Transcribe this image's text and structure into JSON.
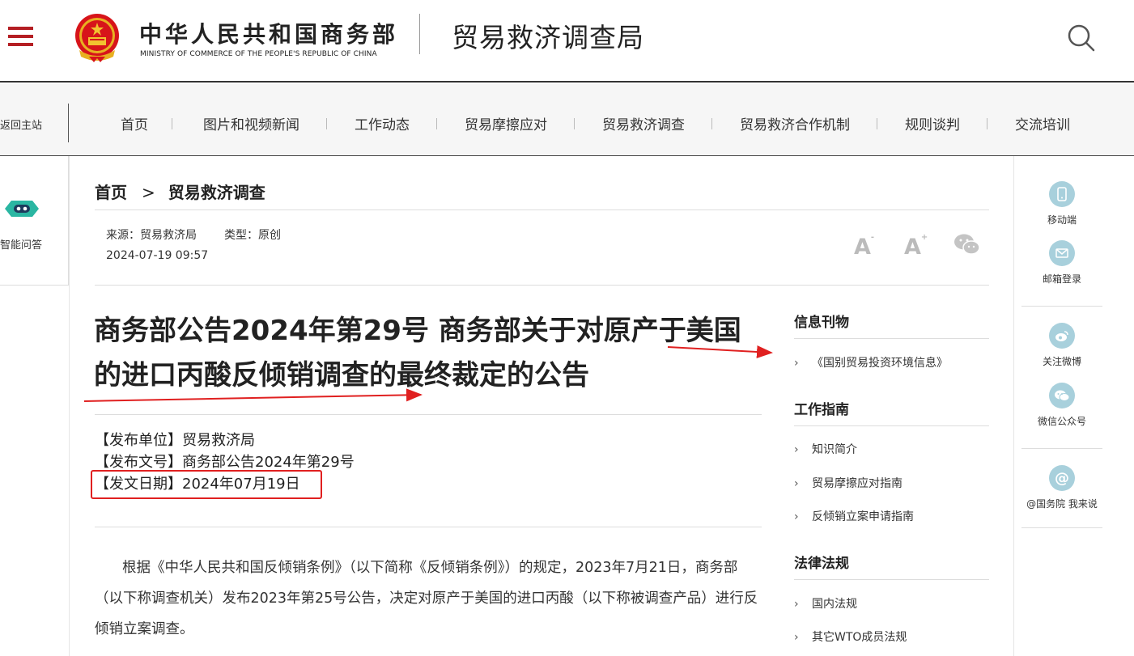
{
  "header": {
    "org_cn": "中华人民共和国商务部",
    "org_en": "MINISTRY OF COMMERCE OF THE PEOPLE'S REPUBLIC OF CHINA",
    "bureau": "贸易救济调查局",
    "menu_icon": "hamburger-menu-icon",
    "search_icon": "search-icon",
    "brand_color": "#b41e23"
  },
  "nav": {
    "back_home": "返回主站",
    "items": [
      "首页",
      "图片和视频新闻",
      "工作动态",
      "贸易摩擦应对",
      "贸易救济调查",
      "贸易救济合作机制",
      "规则谈判",
      "交流培训"
    ]
  },
  "left_panel": {
    "ai_label": "智能问答",
    "icon": "robot-chat-icon"
  },
  "right_panel": {
    "items": [
      {
        "label": "移动端",
        "icon": "mobile-icon"
      },
      {
        "label": "邮箱登录",
        "icon": "mail-icon"
      },
      {
        "label": "关注微博",
        "icon": "weibo-icon"
      },
      {
        "label": "微信公众号",
        "icon": "wechat-icon"
      },
      {
        "label": "@国务院 我来说",
        "icon": "at-icon"
      }
    ]
  },
  "breadcrumb": {
    "home": "首页",
    "sep": ">",
    "current": "贸易救济调查"
  },
  "meta": {
    "source": "来源：贸易救济局",
    "type": "类型：原创",
    "datetime": "2024-07-19 09:57",
    "font_small": "A",
    "font_small_sup": "-",
    "font_large": "A",
    "font_large_sup": "+",
    "share_icon": "wechat-share-icon"
  },
  "article": {
    "title_line1": "商务部公告2024年第29号 商务部关于对原产于美国",
    "title_line2": "的进口丙酸反倾销调查的最终裁定的公告",
    "publisher": "【发布单位】贸易救济局",
    "doc_no": "【发布文号】商务部公告2024年第29号",
    "doc_date": "【发文日期】2024年07月19日",
    "body": "根据《中华人民共和国反倾销条例》（以下简称《反倾销条例》）的规定，2023年7月21日，商务部（以下称调查机关）发布2023年第25号公告，决定对原产于美国的进口丙酸（以下称被调查产品）进行反倾销立案调查。"
  },
  "sidebar": {
    "sections": [
      {
        "title": "信息刊物",
        "links": [
          "《国别贸易投资环境信息》"
        ]
      },
      {
        "title": "工作指南",
        "links": [
          "知识简介",
          "贸易摩擦应对指南",
          "反倾销立案申请指南"
        ]
      },
      {
        "title": "法律法规",
        "links": [
          "国内法规",
          "其它WTO成员法规"
        ]
      }
    ]
  },
  "annotation": {
    "color": "#e02020"
  }
}
